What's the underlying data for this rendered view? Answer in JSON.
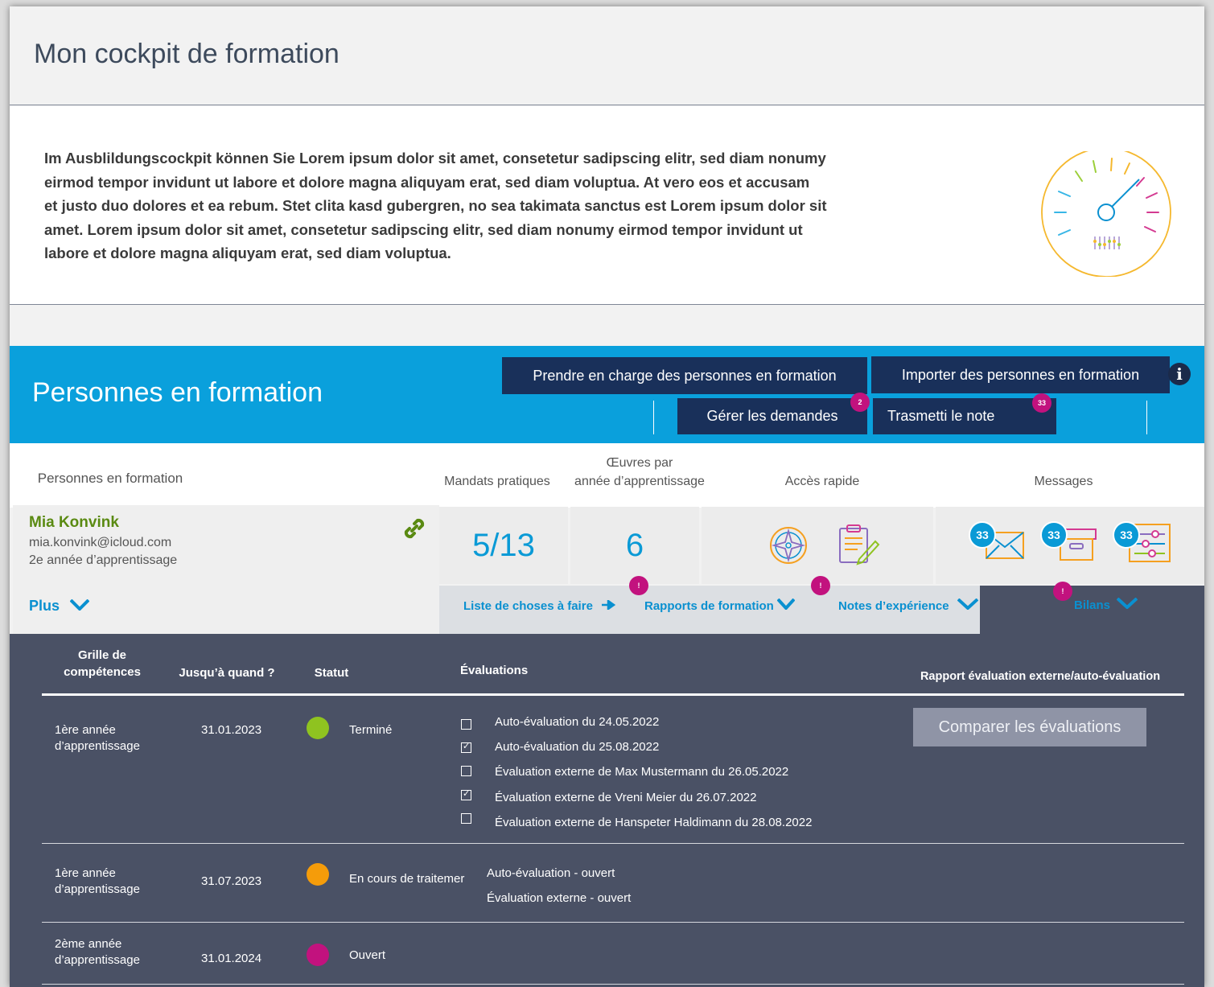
{
  "page": {
    "title": "Mon cockpit de formation"
  },
  "intro": {
    "lines": [
      "Im Ausblildungscockpit können Sie Lorem ipsum dolor sit amet, consetetur sadipscing elitr, sed diam nonumy",
      "eirmod tempor invidunt ut labore et dolore magna aliquyam erat, sed diam voluptua. At vero eos et accusam",
      "et justo duo dolores et ea rebum. Stet clita kasd gubergren, no sea takimata sanctus est Lorem ipsum dolor sit",
      "amet. Lorem ipsum dolor sit amet, consetetur sadipscing elitr, sed diam nonumy eirmod tempor invidunt ut",
      "labore et dolore magna aliquyam erat, sed diam voluptua."
    ]
  },
  "section": {
    "title": "Personnes en formation",
    "buttons": {
      "take_charge": "Prendre en charge des personnes en formation",
      "import": "Importer des personnes en formation",
      "manage": "Gérer les demandes",
      "transmit": "Trasmetti le note"
    },
    "badges": {
      "manage": "2",
      "transmit": "33"
    },
    "info_icon": "i"
  },
  "columns": {
    "trainees": "Personnes en formation",
    "mandates": "Mandats pratiques",
    "works_line1": "Œuvres par",
    "works_line2": "année d’apprentissage",
    "quick": "Accès rapide",
    "messages": "Messages"
  },
  "person": {
    "name": "Mia Konvink",
    "email": "mia.konvink@icloud.com",
    "year": "2e année d’apprentissage",
    "more": "Plus",
    "mandates": "5/13",
    "works": "6",
    "message_counts": [
      "33",
      "33",
      "33"
    ]
  },
  "tabs": {
    "todo": "Liste de choses à faire",
    "reports": "Rapports de formation",
    "notes": "Notes d’expérience",
    "bilans": "Bilans",
    "alert": "!"
  },
  "table": {
    "headers": {
      "grid_line1": "Grille de",
      "grid_line2": "compétences",
      "until": "Jusqu’à quand ?",
      "status": "Statut",
      "evaluations": "Évaluations",
      "report": "Rapport évaluation externe/auto-évaluation"
    },
    "compare_button": "Comparer les évaluations",
    "rows": [
      {
        "grid_line1": "1ère année",
        "grid_line2": "d’apprentissage",
        "date": "31.01.2023",
        "status": "Terminé",
        "status_color": "#8fc320",
        "evaluations": [
          {
            "label": "Auto-évaluation du 24.05.2022",
            "checked": false
          },
          {
            "label": "Auto-évaluation du 25.08.2022",
            "checked": true
          },
          {
            "label": "Évaluation externe de Max Mustermann du 26.05.2022",
            "checked": false
          },
          {
            "label": "Évaluation externe de Vreni Meier du 26.07.2022",
            "checked": true
          },
          {
            "label": "Évaluation externe de Hanspeter Haldimann du 28.08.2022",
            "checked": false
          }
        ]
      },
      {
        "grid_line1": "1ère année",
        "grid_line2": "d’apprentissage",
        "date": "31.07.2023",
        "status": "En cours de traitemer",
        "status_color": "#f59c0a",
        "evaluations": [
          {
            "label": "Auto-évaluation - ouvert"
          },
          {
            "label": "Évaluation externe - ouvert"
          }
        ]
      },
      {
        "grid_line1": "2ème année",
        "grid_line2": "d’apprentissage",
        "date": "31.01.2024",
        "status": "Ouvert",
        "status_color": "#c2127e",
        "evaluations": []
      }
    ]
  },
  "colors": {
    "blue": "#0aa0dc",
    "navy": "#19305a",
    "dark": "#4a5165",
    "magenta": "#c2127e",
    "green_name": "#5a8a12"
  },
  "icons": [
    "gauge-icon",
    "info-icon",
    "link-icon",
    "compass-icon",
    "clipboard-icon",
    "envelope-icon",
    "archive-box-icon",
    "sliders-icon",
    "chevron-down-icon",
    "arrow-right-icon",
    "checkbox-icon"
  ]
}
